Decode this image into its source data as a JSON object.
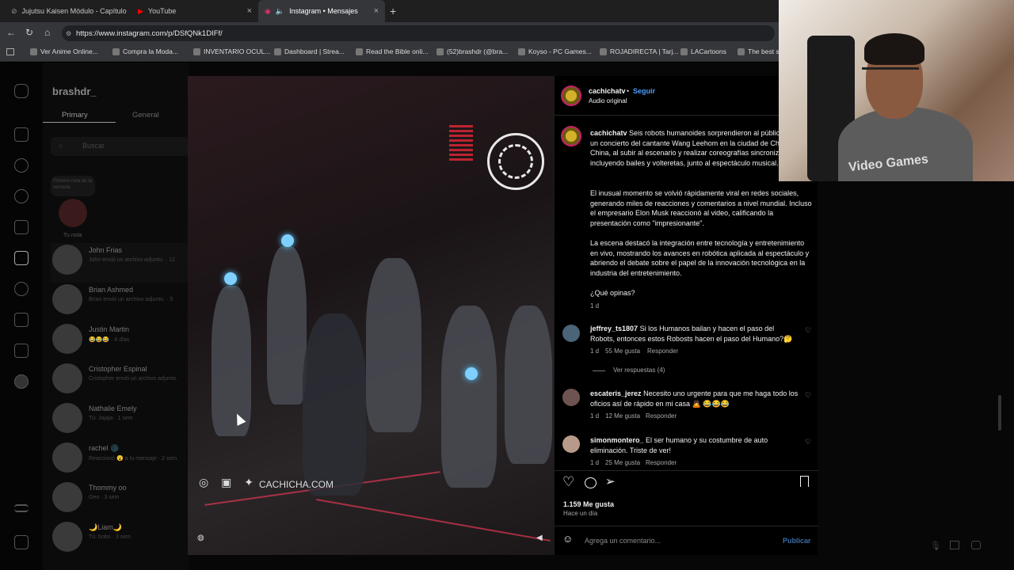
{
  "browser": {
    "tabs": [
      {
        "label": "Jujutsu Kaisen Módulo - Capítulo"
      },
      {
        "label": "YouTube"
      },
      {
        "label": "Instagram • Mensajes"
      }
    ],
    "url": "https://www.instagram.com/p/DSfQNk1DIFf/",
    "bookmarks": [
      "Ver Anime Online...",
      "Compra la Moda...",
      "INVENTARIO OCUL...",
      "Dashboard | Strea...",
      "Read the Bible onli...",
      "(52)brashdr (@bra...",
      "Koyso - PC Games...",
      "ROJADIRECTA | Tarj...",
      "LACartoons",
      "The best st"
    ]
  },
  "dm_sidebar": {
    "username": "brashdr_",
    "tabs": [
      "Primary",
      "General"
    ],
    "search_placeholder": "Buscar",
    "note_text": "Primera nota de la semana",
    "note_label": "Tu nota",
    "conversations": [
      {
        "name": "John Frias",
        "preview": "John envió un archivo adjunto. · 12"
      },
      {
        "name": "Brian Ashmed",
        "preview": "Brian envió un archivo adjunto. · 5"
      },
      {
        "name": "Justin Martin",
        "preview": "😂😂😂 · 6 días"
      },
      {
        "name": "Cristopher Espinal",
        "preview": "Cristopher envió un archivo adjunto."
      },
      {
        "name": "Nathalie Emely",
        "preview": "Tú: Jajaja · 1 sem"
      },
      {
        "name": "rachel 🌑",
        "preview": "Reaccionó 😮 a tu mensaje · 2 sem"
      },
      {
        "name": "Thommy oo",
        "preview": "Gen · 3 sem"
      },
      {
        "name": "🌙Liam🌙",
        "preview": "Tú: bobo · 3 sem"
      }
    ]
  },
  "video": {
    "watermark": "CACHICHA.COM"
  },
  "post": {
    "author": "cachichatv",
    "follow_label": "Seguir",
    "audio_label": "Audio original",
    "caption_author": "cachichatv",
    "caption_p1": "Seis robots humanoides sorprendieron al público durante un concierto del cantante Wang Leehom en la ciudad de Chengdu, China, al subir al escenario y realizar coreografías sincronizadas, incluyendo bailes y volteretas, junto al espectáculo musical.",
    "caption_p2": "El inusual momento se volvió rápidamente viral en redes sociales, generando miles de reacciones y comentarios a nivel mundial. Incluso el empresario Elon Musk reaccionó al video, calificando la presentación como \"impresionante\".",
    "caption_p3": "La escena destacó la integración entre tecnología y entretenimiento en vivo, mostrando los avances en robótica aplicada al espectáculo y abriendo el debate sobre el papel de la innovación tecnológica en la industria del entretenimiento.",
    "caption_p4": "¿Qué opinas?",
    "caption_time": "1 d",
    "comments": [
      {
        "user": "jeffrey_ts1807",
        "text": "Si los Humanos bailan y hacen el paso del Robots, entonces estos Robosts hacen el paso del Humano?🤔",
        "time": "1 d",
        "likes": "55 Me gusta",
        "reply": "Responder",
        "replies": "Ver respuestas (4)"
      },
      {
        "user": "escateris_jerez",
        "text": "Necesito uno urgente para que me haga todo los oficios así de rápido en mi casa 🙇 😂😂😂",
        "time": "1 d",
        "likes": "12 Me gusta",
        "reply": "Responder"
      },
      {
        "user": "simonmontero_",
        "text": "El ser humano y su costumbre de auto eliminación. Triste de ver!",
        "time": "1 d",
        "likes": "25 Me gusta",
        "reply": "Responder"
      }
    ],
    "likes_count": "1.159 Me gusta",
    "posted_time": "Hace un día",
    "comment_placeholder": "Agrega un comentario...",
    "publish_label": "Publicar"
  },
  "webcam": {
    "shirt_text": "Video Games"
  },
  "colors": {
    "link_blue": "#4f9cf9",
    "ig_bg": "#000000",
    "chrome_bg": "#35363a"
  }
}
